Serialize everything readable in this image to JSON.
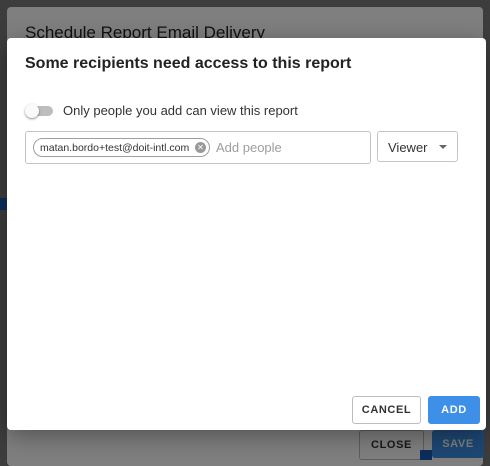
{
  "background_dialog": {
    "title": "Schedule Report Email Delivery",
    "close_label": "CLOSE",
    "save_label": "SAVE"
  },
  "dialog": {
    "title": "Some recipients need access to this report",
    "toggle": {
      "label": "Only people you add can view this report",
      "checked": false
    },
    "people": {
      "chips": [
        "matan.bordo+test@doit-intl.com"
      ],
      "placeholder": "Add people",
      "value": ""
    },
    "role": {
      "selected": "Viewer"
    },
    "cancel_label": "CANCEL",
    "add_label": "ADD"
  },
  "colors": {
    "primary": "#3d8fe8",
    "scrim": "rgba(0,0,0,0.5)"
  },
  "icons": {
    "chip_remove": "close-circle-icon",
    "role_caret": "caret-down-icon"
  }
}
